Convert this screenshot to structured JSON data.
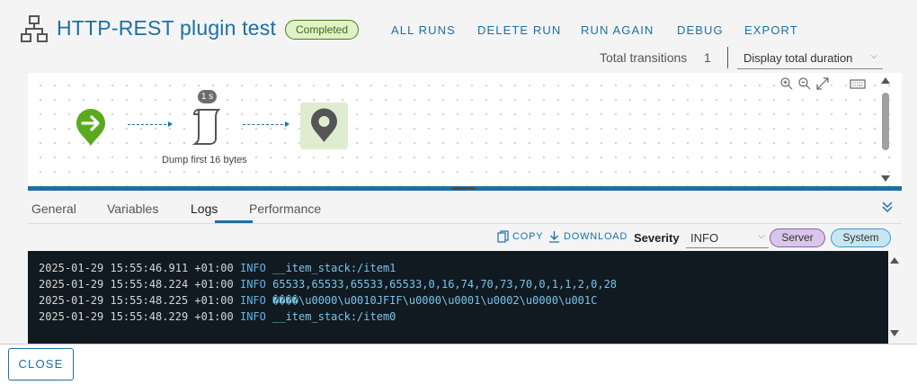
{
  "header": {
    "title": "HTTP-REST plugin test",
    "status_badge": "Completed",
    "actions": [
      "ALL RUNS",
      "DELETE RUN",
      "RUN AGAIN",
      "DEBUG",
      "EXPORT"
    ]
  },
  "summary": {
    "total_transitions_label": "Total transitions",
    "total_transitions_value": "1",
    "duration_select": "Display total duration"
  },
  "canvas": {
    "node_duration": "1 s",
    "node_label": "Dump first 16 bytes"
  },
  "tabs": [
    "General",
    "Variables",
    "Logs",
    "Performance"
  ],
  "active_tab": "Logs",
  "log_toolbar": {
    "copy_label": "COPY",
    "download_label": "DOWNLOAD",
    "severity_label": "Severity",
    "severity_value": "INFO",
    "filter_server": "Server",
    "filter_system": "System"
  },
  "logs": [
    {
      "ts": "2025-01-29 15:55:46.911 +01:00",
      "level": "INFO",
      "msg": "__item_stack:/item1"
    },
    {
      "ts": "2025-01-29 15:55:48.224 +01:00",
      "level": "INFO",
      "msg": "65533,65533,65533,65533,0,16,74,70,73,70,0,1,1,2,0,28"
    },
    {
      "ts": "2025-01-29 15:55:48.225 +01:00",
      "level": "INFO",
      "msg": "����\\u0000\\u0010JFIF\\u0000\\u0001\\u0002\\u0000\\u001C"
    },
    {
      "ts": "2025-01-29 15:55:48.229 +01:00",
      "level": "INFO",
      "msg": "__item_stack:/item0"
    }
  ],
  "footer": {
    "close_label": "CLOSE"
  },
  "colors": {
    "accent": "#1d6fa5",
    "badge_bg": "#e1f1c8",
    "start_node": "#5aaa1f",
    "console_bg": "#111a21"
  }
}
